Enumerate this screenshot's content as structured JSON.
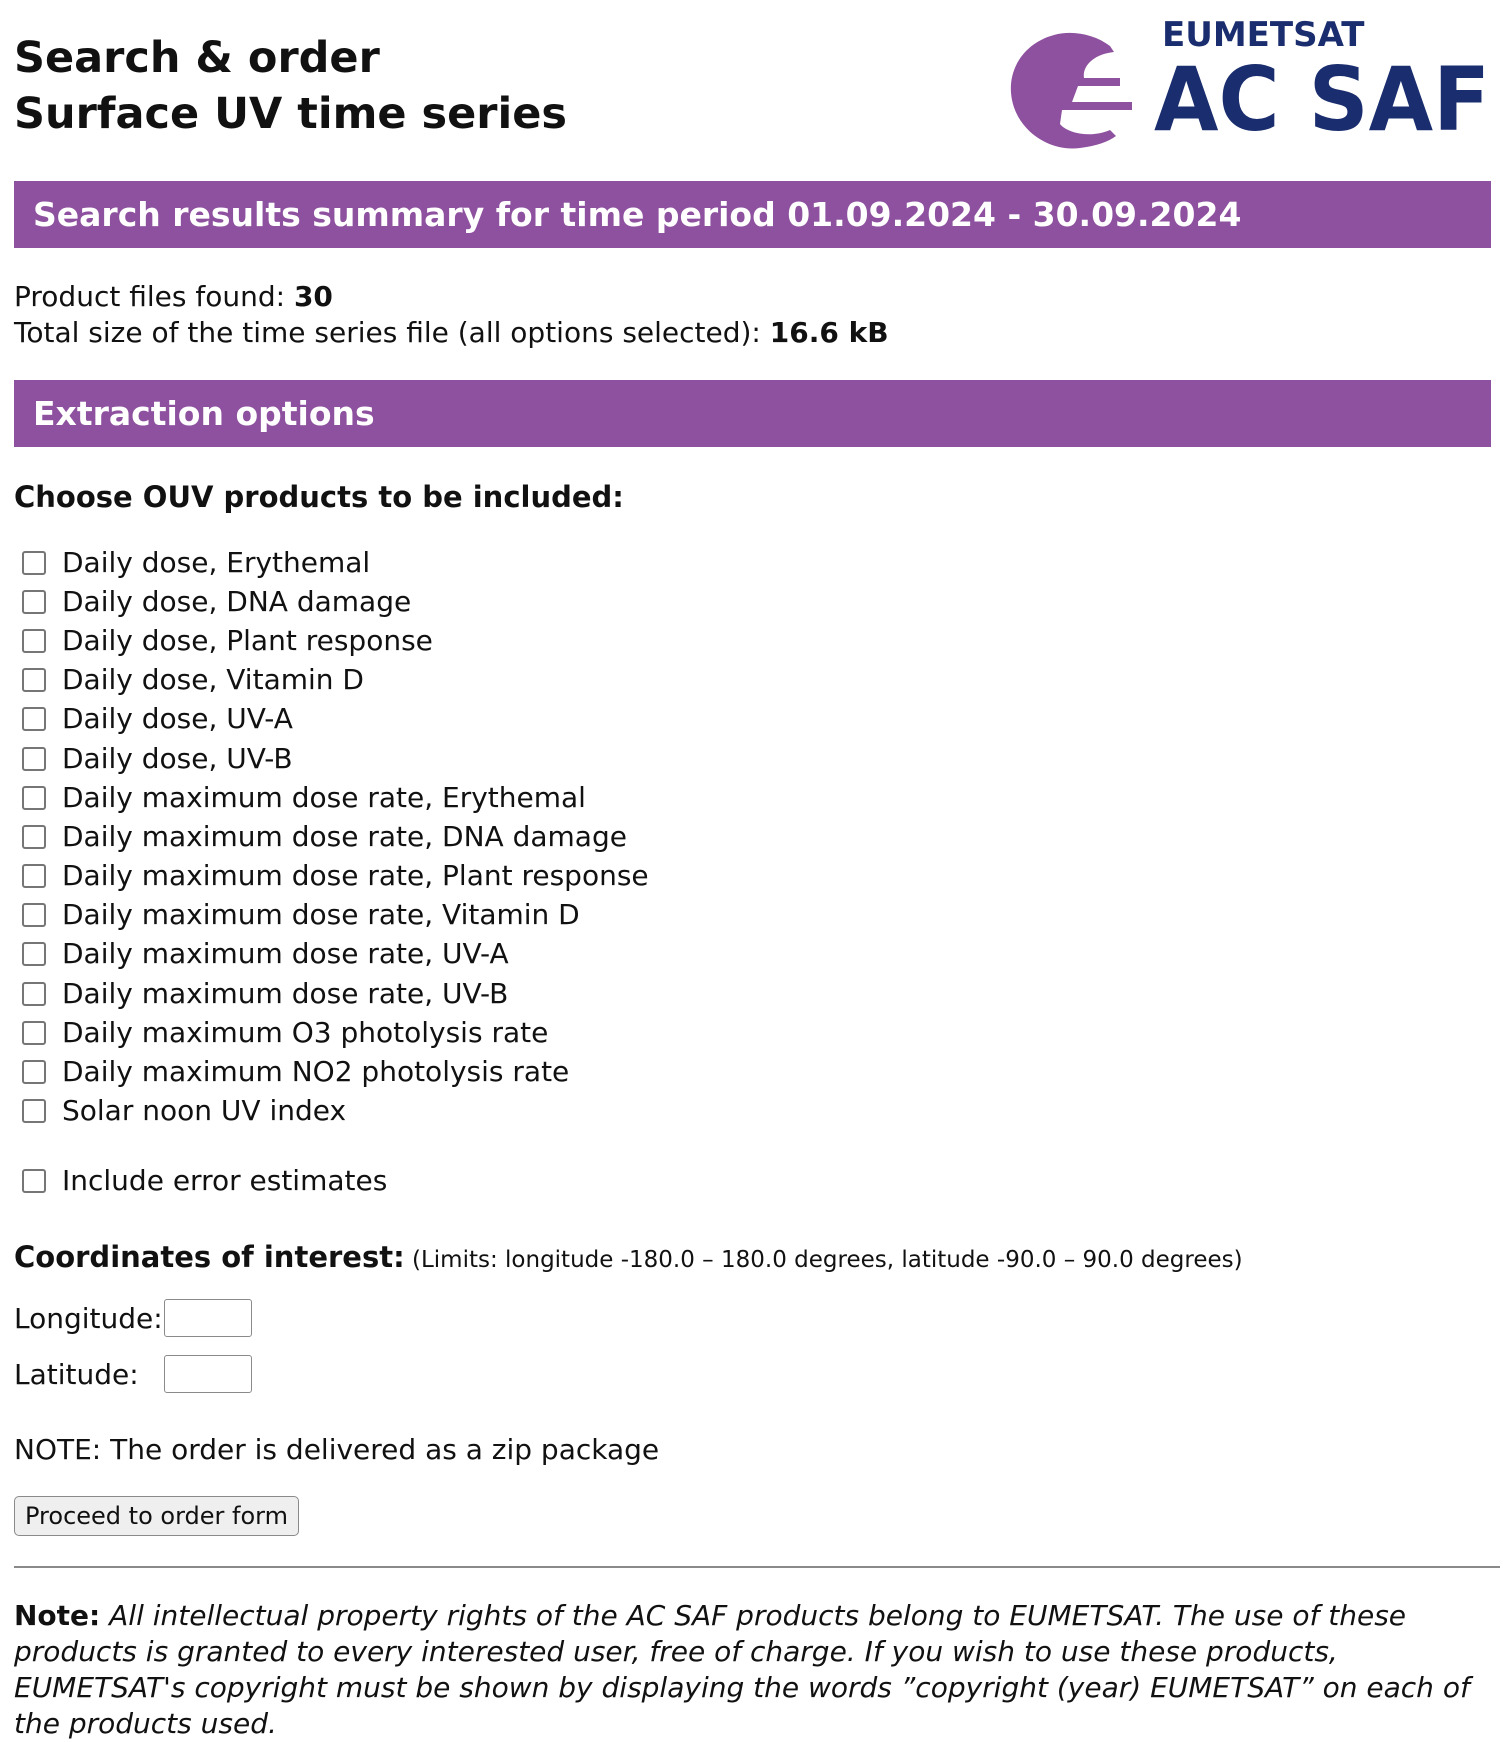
{
  "header": {
    "title_line1": "Search & order",
    "title_line2": "Surface UV time series",
    "logo": {
      "org_text": "EUMETSAT",
      "name_text": "AC SAF",
      "icon": "eumetsat-swoosh-icon",
      "org_color": "#1a2d6e",
      "icon_color": "#8e519f"
    }
  },
  "results_bar": {
    "title": "Search results summary for time period 01.09.2024 - 30.09.2024"
  },
  "summary": {
    "files_label": "Product files found: ",
    "files_value": "30",
    "size_label": "Total size of the time series file (all options selected): ",
    "size_value": "16.6 kB"
  },
  "options_bar": {
    "title": "Extraction options"
  },
  "products": {
    "heading": "Choose OUV products to be included:",
    "items": [
      {
        "label": "Daily dose, Erythemal",
        "checked": false
      },
      {
        "label": "Daily dose, DNA damage",
        "checked": false
      },
      {
        "label": "Daily dose, Plant response",
        "checked": false
      },
      {
        "label": "Daily dose, Vitamin D",
        "checked": false
      },
      {
        "label": "Daily dose, UV-A",
        "checked": false
      },
      {
        "label": "Daily dose, UV-B",
        "checked": false
      },
      {
        "label": "Daily maximum dose rate, Erythemal",
        "checked": false
      },
      {
        "label": "Daily maximum dose rate, DNA damage",
        "checked": false
      },
      {
        "label": "Daily maximum dose rate, Plant response",
        "checked": false
      },
      {
        "label": "Daily maximum dose rate, Vitamin D",
        "checked": false
      },
      {
        "label": "Daily maximum dose rate, UV-A",
        "checked": false
      },
      {
        "label": "Daily maximum dose rate, UV-B",
        "checked": false
      },
      {
        "label": "Daily maximum O3 photolysis rate",
        "checked": false
      },
      {
        "label": "Daily maximum NO2 photolysis rate",
        "checked": false
      },
      {
        "label": "Solar noon UV index",
        "checked": false
      }
    ],
    "error_estimates": {
      "label": "Include error estimates",
      "checked": false
    }
  },
  "coordinates": {
    "heading": "Coordinates of interest:",
    "limits": " (Limits: longitude -180.0 – 180.0 degrees, latitude -90.0 – 90.0 degrees)",
    "longitude_label": "Longitude:",
    "longitude_value": "",
    "latitude_label": "Latitude:",
    "latitude_value": ""
  },
  "zip_note": "NOTE: The order is delivered as a zip package",
  "proceed_button": "Proceed to order form",
  "footer": {
    "note_label": "Note:",
    "note_text": " All intellectual property rights of the AC SAF products belong to EUMETSAT. The use of these products is granted to every interested user, free of charge. If you wish to use these products, EUMETSAT's copyright must be shown by displaying the words ”copyright (year) EUMETSAT” on each of the products used."
  }
}
